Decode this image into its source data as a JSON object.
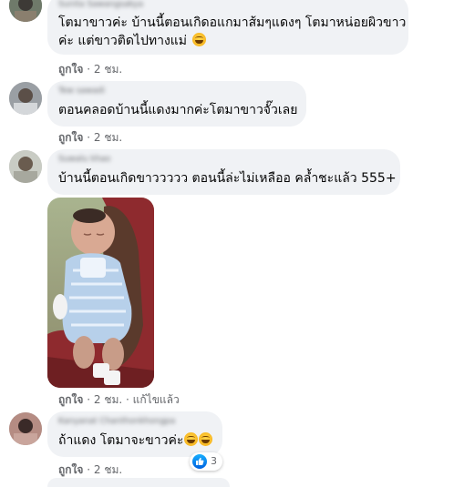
{
  "comments": [
    {
      "author": "Sunita Sawangsakya",
      "text": "โตมาขาวค่ะ บ้านนี้ตอนเกิดอแกมาส้มๆแดงๆ โตมาหน่อยผิวขาว\nค่ะ แต่ขาวติดไปทางแม่",
      "like": "ถูกใจ",
      "time": "2 ชม."
    },
    {
      "author": "Tew sawadi",
      "text": "ตอนคลอดบ้านนี้แดงมากค่ะโตมาขาวจั๊วเลย",
      "like": "ถูกใจ",
      "time": "2 ชม."
    },
    {
      "author": "Suwalu khao",
      "text": "บ้านนี้ตอนเกิดขาววววว ตอนนี้ล่ะไม่เหลืออ คล้ำชะแล้ว 555+",
      "like": "ถูกใจ",
      "time": "2 ชม.",
      "edited": "แก้ไขแล้ว"
    },
    {
      "author": "Kanyanat Chanthonkhongpa",
      "text": "ถ้าแดง โตมาจะขาวค่ะ",
      "like": "ถูกใจ",
      "time": "2 ชม.",
      "reaction_count": "3"
    }
  ],
  "separator": " · ",
  "icons": {
    "emoji": "grin-emoji-icon",
    "reaction": "thumbs-up-icon"
  },
  "colors": {
    "bubble": "#f0f2f5",
    "meta_text": "#65676b",
    "reaction_blue": "#1877f2"
  }
}
